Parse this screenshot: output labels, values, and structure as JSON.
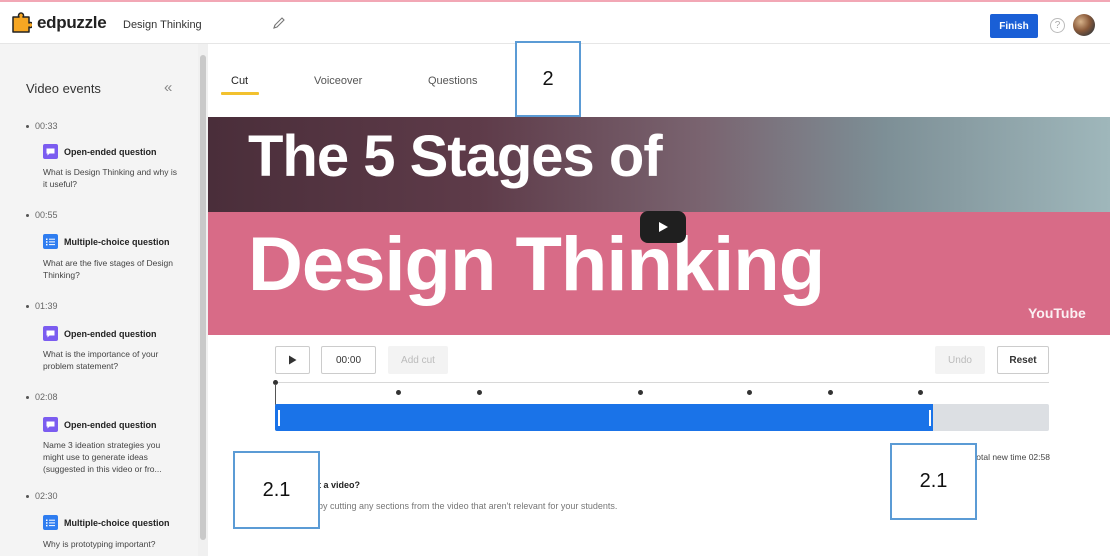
{
  "header": {
    "logo_text": "edpuzzle",
    "project_title": "Design Thinking",
    "finish_label": "Finish",
    "help_symbol": "?"
  },
  "sidebar": {
    "title": "Video events",
    "collapse_symbol": "«",
    "events": [
      {
        "time": "00:33",
        "type": "Open-ended question",
        "kind": "open-ended",
        "text": "What is Design Thinking and why is it useful?"
      },
      {
        "time": "00:55",
        "type": "Multiple-choice question",
        "kind": "multiple-choice",
        "text": "What are the five stages of Design Thinking?"
      },
      {
        "time": "01:39",
        "type": "Open-ended question",
        "kind": "open-ended",
        "text": "What is the importance of your problem statement?"
      },
      {
        "time": "02:08",
        "type": "Open-ended question",
        "kind": "open-ended",
        "text": "Name 3 ideation strategies you might use to generate ideas (suggested in this video or fro..."
      },
      {
        "time": "02:30",
        "type": "Multiple-choice question",
        "kind": "multiple-choice",
        "text": "Why is prototyping important?"
      }
    ]
  },
  "tabs": {
    "cut": "Cut",
    "voiceover": "Voiceover",
    "questions": "Questions"
  },
  "callouts": {
    "top": "2",
    "left": "2.1",
    "right": "2.1"
  },
  "video": {
    "title_line1": "The 5 Stages of",
    "title_line2": "Design Thinking",
    "platform": "YouTube"
  },
  "cut_controls": {
    "time": "00:00",
    "add_cut": "Add cut",
    "undo": "Undo",
    "reset": "Reset",
    "total_time": "Total new time 02:58",
    "help_question": "t a video?",
    "help_description": "by cutting any sections from the video that aren't relevant for your students."
  },
  "colors": {
    "accent": "#1a5fd6",
    "tab_underline": "#f2c12e",
    "open_ended": "#7b5cf0",
    "multiple_choice": "#2f7df0",
    "cut_track": "#1a73e8",
    "callout_border": "#5b9bd5"
  }
}
